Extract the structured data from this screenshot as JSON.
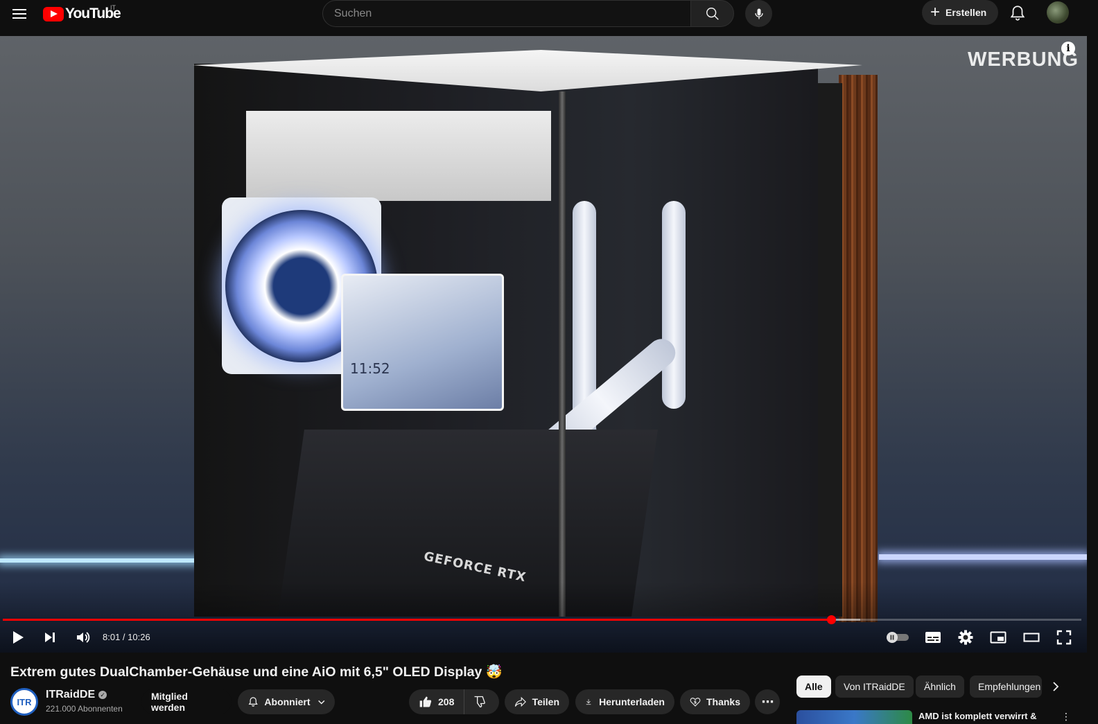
{
  "header": {
    "logo_text": "YouTube",
    "country_code": "IT",
    "search_placeholder": "Suchen",
    "create_label": "Erstellen"
  },
  "player": {
    "ad_label": "WERBUNG",
    "ad_info_glyph": "i",
    "time_current": "8:01",
    "time_total": "10:26",
    "time_display": "8:01 / 10:26",
    "progress_fraction": 0.768,
    "buffered_fraction": 0.795,
    "overlay_texts": {
      "pump_time": "11:52",
      "gpu_label": "GEFORCE RTX"
    }
  },
  "video": {
    "title": "Extrem gutes DualChamber-Gehäuse und eine AiO mit 6,5\" OLED Display 🤯",
    "channel_name": "ITRaidDE",
    "channel_avatar_text": "ITR",
    "subscribers": "221.000 Abonnenten",
    "join_label": "Mitglied werden",
    "subscribed_label": "Abonniert",
    "likes": "208",
    "share_label": "Teilen",
    "download_label": "Herunterladen",
    "thanks_label": "Thanks",
    "more_glyph": "⋯"
  },
  "sidebar": {
    "chips": [
      "Alle",
      "Von ITRaidDE",
      "Ähnlich",
      "Empfehlungen"
    ],
    "active_chip": "Alle",
    "rec_title": "AMD ist komplett verwirrt &"
  },
  "colors": {
    "brand_red": "#ff0000",
    "background": "#0f0f0f",
    "chip_bg": "#272727",
    "progress_red": "#ff0000"
  },
  "icons": [
    "menu-icon",
    "youtube-logo-icon",
    "search-icon",
    "mic-icon",
    "plus-icon",
    "bell-icon",
    "info-icon",
    "play-icon",
    "next-icon",
    "volume-icon",
    "autoplay-toggle-icon",
    "subtitles-icon",
    "settings-icon",
    "miniplayer-icon",
    "theater-icon",
    "fullscreen-icon",
    "verified-icon",
    "bell-outline-icon",
    "chevron-down-icon",
    "thumb-up-icon",
    "thumb-down-icon",
    "share-icon",
    "download-icon",
    "thanks-icon",
    "more-icon",
    "chevron-right-icon"
  ]
}
